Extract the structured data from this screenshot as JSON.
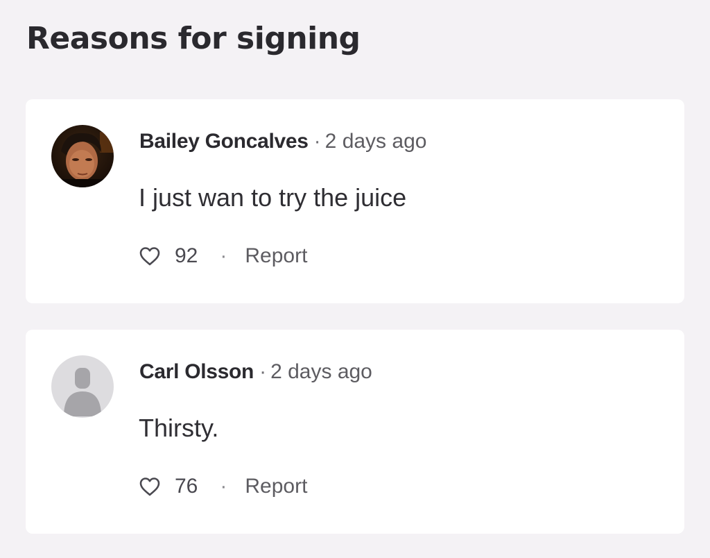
{
  "section": {
    "title": "Reasons for signing"
  },
  "comments": [
    {
      "author": "Bailey Goncalves",
      "separator": "·",
      "time": "2 days ago",
      "text": "I just wan to try the juice",
      "likes": "92",
      "action_separator": "·",
      "report_label": "Report",
      "avatar": "user-photo"
    },
    {
      "author": "Carl Olsson",
      "separator": "·",
      "time": "2 days ago",
      "text": "Thirsty.",
      "likes": "76",
      "action_separator": "·",
      "report_label": "Report",
      "avatar": "default-person-icon"
    }
  ],
  "icons": {
    "like": "heart-outline-icon"
  },
  "colors": {
    "background": "#f4f2f5",
    "card": "#ffffff",
    "text": "#29282d",
    "muted": "#5d5c61"
  }
}
